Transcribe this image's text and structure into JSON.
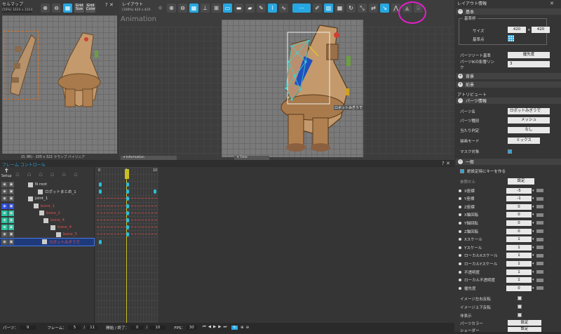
{
  "cellmap": {
    "title": "セルマップ",
    "subtitle": "(50%) 1024 x 1024",
    "status": "(0, 86) - 205 x 322  クランプ  バイリニア",
    "grid_size": "Grid\nSize",
    "grid_color": "Grid\nColor"
  },
  "layout": {
    "title": "レイアウト",
    "subtitle": "(100%) 420 x 420",
    "tab_label": "Animation",
    "info_tab": "Information",
    "time_tab": "Time",
    "part_label": "ロボットみぎうで"
  },
  "layout_info": {
    "title": "レイアウト情報",
    "basic": "基本",
    "base_frame": "基準枠",
    "size_label": "サイズ",
    "size_w": "420",
    "size_x": "×",
    "size_h": "420",
    "base_point": "基準点",
    "sort_label": "パーツソート基準",
    "sort_value": "優先度",
    "ik_label": "パーツIKの影響リンク",
    "ik_value": "3",
    "bg": "背景",
    "fg": "前景",
    "attribute": "アトリビュート",
    "parts_info": "パーツ情報",
    "part_name_label": "パーツ名",
    "part_name": "ロボットみぎうで",
    "part_type_label": "パーツ種別",
    "part_type": "メッシュ",
    "hit_label": "当たり判定",
    "hit_value": "なし",
    "draw_label": "描画モード",
    "draw_value": "ミックス",
    "mask_label": "マスク対象",
    "general": "一般",
    "set_key": "絶設定時にキーを作る",
    "ref_cell": "参照セル",
    "settings_btn": "設定",
    "props": [
      {
        "label": "X座標",
        "value": "-5"
      },
      {
        "label": "Y座標",
        "value": "-1"
      },
      {
        "label": "Z座標",
        "value": "0"
      },
      {
        "label": "X軸回転",
        "value": "0"
      },
      {
        "label": "Y軸回転",
        "value": "0"
      },
      {
        "label": "Z軸回転",
        "value": "0"
      },
      {
        "label": "Xスケール",
        "value": "1"
      },
      {
        "label": "Yスケール",
        "value": "1"
      },
      {
        "label": "ローカルXスケール",
        "value": "1"
      },
      {
        "label": "ローカルYスケール",
        "value": "1"
      },
      {
        "label": "不透明度",
        "value": "1"
      },
      {
        "label": "ローカル不透明度",
        "value": "1"
      },
      {
        "label": "優先度",
        "value": "0"
      }
    ],
    "flip_h": "イメージ左右反転",
    "flip_v": "イメージ上下反転",
    "hidden": "非表示",
    "part_color": "パーツカラー",
    "shader": "シェーダー",
    "settings_btn2": "設定",
    "settings_btn3": "設定"
  },
  "frame_control": {
    "title": "フレーム コントロール",
    "setup": "Setup",
    "parts": [
      {
        "label": "N  root"
      },
      {
        "label": "ロボットまとめ_1"
      },
      {
        "label": "joint_1"
      },
      {
        "label": "bone_1"
      },
      {
        "label": "bone_2"
      },
      {
        "label": "bone_4"
      },
      {
        "label": "bone_4"
      },
      {
        "label": "bone_5"
      },
      {
        "label": "ロボットみぎうで"
      }
    ],
    "tick_0": "0",
    "tick_5": "5",
    "tick_10": "10"
  },
  "statusbar": {
    "parts_label": "パーツ：",
    "parts_value": "9",
    "frame_label": "フレーム：",
    "frame_value": "5",
    "frame_total": "11",
    "range_label": "開始 / 終了：",
    "start": "0",
    "end": "10",
    "fps_label": "FPS：",
    "fps": "30"
  },
  "highlight_color": "#e020c8",
  "accent_color": "#27a7e0"
}
